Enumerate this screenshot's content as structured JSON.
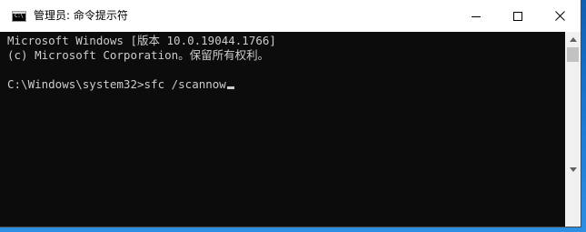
{
  "window": {
    "title": "管理员: 命令提示符",
    "icon": "cmd-app-icon",
    "controls": {
      "minimize": "minimize-icon",
      "maximize": "maximize-icon",
      "close": "close-icon"
    }
  },
  "console": {
    "lines": [
      "Microsoft Windows [版本 10.0.19044.1766]",
      "(c) Microsoft Corporation。保留所有权利。",
      "",
      "C:\\Windows\\system32>sfc /scannow"
    ],
    "background": "#0c0c0c",
    "foreground": "#cccccc"
  },
  "scrollbar": {
    "up_icon": "scroll-up-arrow-icon",
    "down_icon": "scroll-down-arrow-icon"
  }
}
